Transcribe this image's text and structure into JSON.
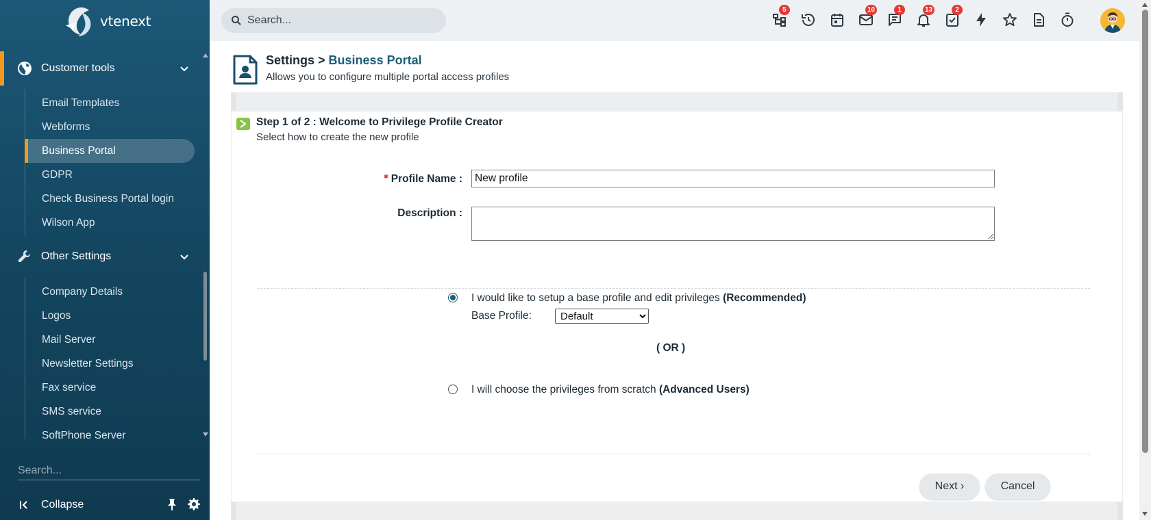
{
  "app": {
    "logo_text": "vtenext"
  },
  "sidebar": {
    "sections": [
      {
        "label": "Customer tools",
        "icon": "globe-icon"
      },
      {
        "label": "Other Settings",
        "icon": "wrench-icon"
      }
    ],
    "customer_tools_items": [
      {
        "label": "Email Templates"
      },
      {
        "label": "Webforms"
      },
      {
        "label": "Business Portal"
      },
      {
        "label": "GDPR"
      },
      {
        "label": "Check Business Portal login"
      },
      {
        "label": "Wilson App"
      }
    ],
    "other_settings_items": [
      {
        "label": "Company Details"
      },
      {
        "label": "Logos"
      },
      {
        "label": "Mail Server"
      },
      {
        "label": "Newsletter Settings"
      },
      {
        "label": "Fax service"
      },
      {
        "label": "SMS service"
      },
      {
        "label": "SoftPhone Server"
      }
    ],
    "search_placeholder": "Search...",
    "collapse_label": "Collapse"
  },
  "topbar": {
    "search_placeholder": "Search...",
    "icons": [
      {
        "name": "hierarchy-icon",
        "badge": "5"
      },
      {
        "name": "history-icon",
        "badge": ""
      },
      {
        "name": "calendar-icon",
        "badge": ""
      },
      {
        "name": "mail-icon",
        "badge": "10"
      },
      {
        "name": "chat-icon",
        "badge": "1"
      },
      {
        "name": "bell-icon",
        "badge": "13"
      },
      {
        "name": "tasks-icon",
        "badge": "2"
      },
      {
        "name": "bolt-icon",
        "badge": ""
      },
      {
        "name": "star-icon",
        "badge": ""
      },
      {
        "name": "document-icon",
        "badge": ""
      },
      {
        "name": "timer-icon",
        "badge": ""
      }
    ]
  },
  "page": {
    "breadcrumb_root": "Settings >",
    "breadcrumb_current": "Business Portal",
    "subtitle": "Allows you to configure multiple portal access profiles"
  },
  "wizard": {
    "step_title": "Step 1 of 2 : Welcome to Privilege Profile Creator",
    "step_subtitle": "Select how to create the new profile",
    "profile_name_label": "Profile Name :",
    "profile_name_value": "New profile",
    "description_label": "Description :",
    "option1_text": "I would like to setup a base profile and edit privileges",
    "option1_emph": "(Recommended)",
    "base_profile_label": "Base Profile:",
    "base_profile_selected": "Default",
    "or_text": "( OR )",
    "option2_text": "I will choose the privileges from scratch",
    "option2_emph": "(Advanced Users)",
    "next_label": "Next ›",
    "cancel_label": "Cancel"
  },
  "colors": {
    "accent": "#f29a1f",
    "sidebar_bg": "#144761",
    "link": "#1a5f7a",
    "badge": "#e53935"
  }
}
